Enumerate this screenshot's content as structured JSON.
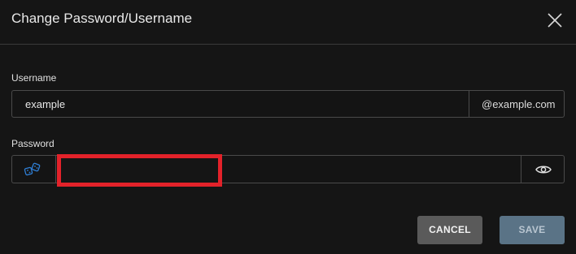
{
  "dialog": {
    "title": "Change Password/Username",
    "close_icon": "close-icon"
  },
  "username": {
    "label": "Username",
    "value": "example",
    "domain_suffix": "@example.com"
  },
  "password": {
    "label": "Password",
    "value": "",
    "generate_icon": "dice-icon",
    "visibility_icon": "eye-icon",
    "redaction_color": "#e3222a"
  },
  "actions": {
    "cancel_label": "CANCEL",
    "save_label": "SAVE"
  },
  "colors": {
    "background": "#151515",
    "accent_icon": "#2f7fd6",
    "cancel_bg": "#5a5a5a",
    "save_bg_disabled": "#5a7386"
  }
}
